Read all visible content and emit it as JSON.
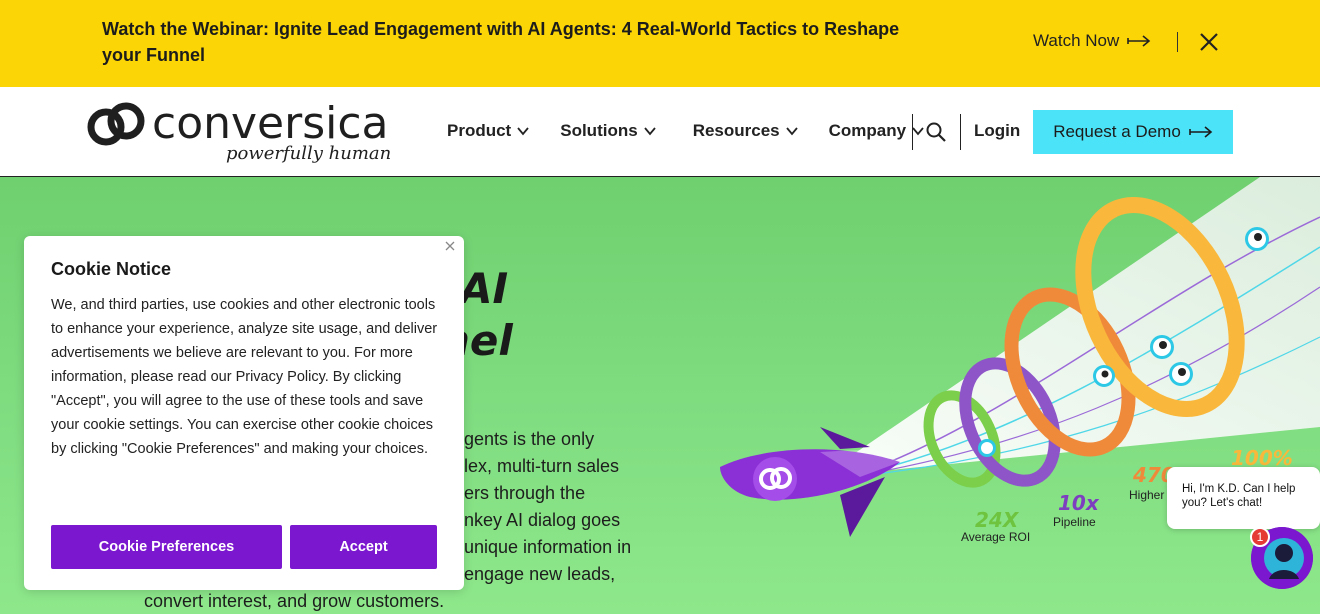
{
  "announcement": {
    "lead": "Watch the Webinar:",
    "text": " Ignite Lead Engagement with AI Agents: 4 Real-World Tactics to Reshape your Funnel",
    "cta": "Watch Now"
  },
  "header": {
    "logo_word": "conversica",
    "logo_tagline": "powerfully human",
    "nav": [
      {
        "label": "Product"
      },
      {
        "label": "Solutions"
      },
      {
        "label": "Resources"
      },
      {
        "label": "Company"
      }
    ],
    "login": "Login",
    "demo": "Request a Demo"
  },
  "hero": {
    "heading_line1": "AI",
    "heading_line2": "nel",
    "body_lines": [
      "gents is the only",
      "lex, multi-turn sales",
      "ers through the",
      "nkey AI dialog goes",
      "unique information in",
      "engage new leads,",
      "convert interest, and grow customers."
    ],
    "stats": [
      {
        "value": "24X",
        "label": "Average ROI"
      },
      {
        "value": "10x",
        "label": "Pipeline"
      },
      {
        "value": "470",
        "label": "Higher Conve"
      },
      {
        "value": "100%",
        "label": ""
      }
    ]
  },
  "cookie": {
    "title": "Cookie Notice",
    "body": "We, and third parties, use cookies and other electronic tools to enhance your experience, analyze site usage, and deliver advertisements we believe are relevant to you. For more information, please read our Privacy Policy. By clicking \"Accept\", you will agree to the use of these tools and save your cookie settings. You can exercise other cookie choices by clicking \"Cookie Preferences\" and making your choices.",
    "preferences": "Cookie Preferences",
    "accept": "Accept"
  },
  "chat": {
    "message": "Hi, I'm K.D. Can I help you? Let's chat!",
    "badge": "1"
  },
  "colors": {
    "banner": "#fbd505",
    "demo_button": "#4be3f7",
    "purple": "#7b18cf",
    "hero_green": "#82de82"
  }
}
